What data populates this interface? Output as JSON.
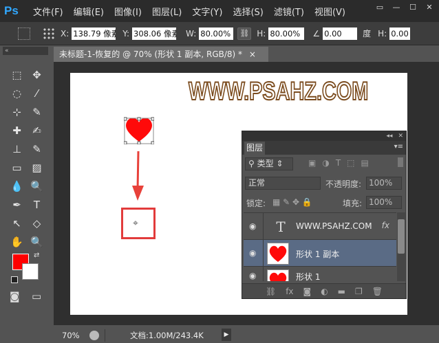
{
  "app": {
    "logo": "Ps"
  },
  "menu": [
    "文件(F)",
    "编辑(E)",
    "图像(I)",
    "图层(L)",
    "文字(Y)",
    "选择(S)",
    "滤镜(T)",
    "视图(V)"
  ],
  "window_controls": [
    "▭",
    "—",
    "☐",
    "✕"
  ],
  "options": {
    "x_label": "X:",
    "x_value": "138.79 像素",
    "y_label": "Y:",
    "y_value": "308.06 像素",
    "w_label": "W:",
    "w_value": "80.00%",
    "h_label": "H:",
    "h_value": "80.00%",
    "angle_value": "0.00",
    "angle_unit": "度",
    "h2_label": "H:",
    "h2_value": "0.00"
  },
  "toolbar": {
    "tools": [
      "⬚",
      "✥",
      "◌",
      "⁄",
      "⊹",
      "✎",
      "✚",
      "✍",
      "⊥",
      "✎",
      "▭",
      "▨",
      "💧",
      "🔍",
      "✒",
      "T",
      "↖",
      "◇",
      "✋",
      "🔍"
    ],
    "foreground_color": "#ff0000",
    "background_color": "#ffffff"
  },
  "document": {
    "tab_title": "未标题-1-恢复的 @ 70% (形状 1 副本, RGB/8) *",
    "tab_close": "×",
    "watermark": "WWW.PSAHZ.COM"
  },
  "status": {
    "zoom": "70%",
    "doc_size": "文档:1.00M/243.4K"
  },
  "layers_panel": {
    "tab": "图层",
    "kind_filter": "类型",
    "blend_mode": "正常",
    "opacity_label": "不透明度:",
    "opacity_value": "100%",
    "lock_label": "锁定:",
    "fill_label": "填充:",
    "fill_value": "100%",
    "layers": [
      {
        "name": "WWW.PSAHZ.COM",
        "type": "text",
        "fx": "fx"
      },
      {
        "name": "形状 1 副本",
        "type": "shape",
        "selected": true
      },
      {
        "name": "形状 1",
        "type": "shape"
      }
    ],
    "bottom_icons": [
      "link-icon",
      "fx-icon",
      "mask-icon",
      "adjustment-icon",
      "group-icon",
      "new-layer-icon",
      "trash-icon"
    ]
  }
}
